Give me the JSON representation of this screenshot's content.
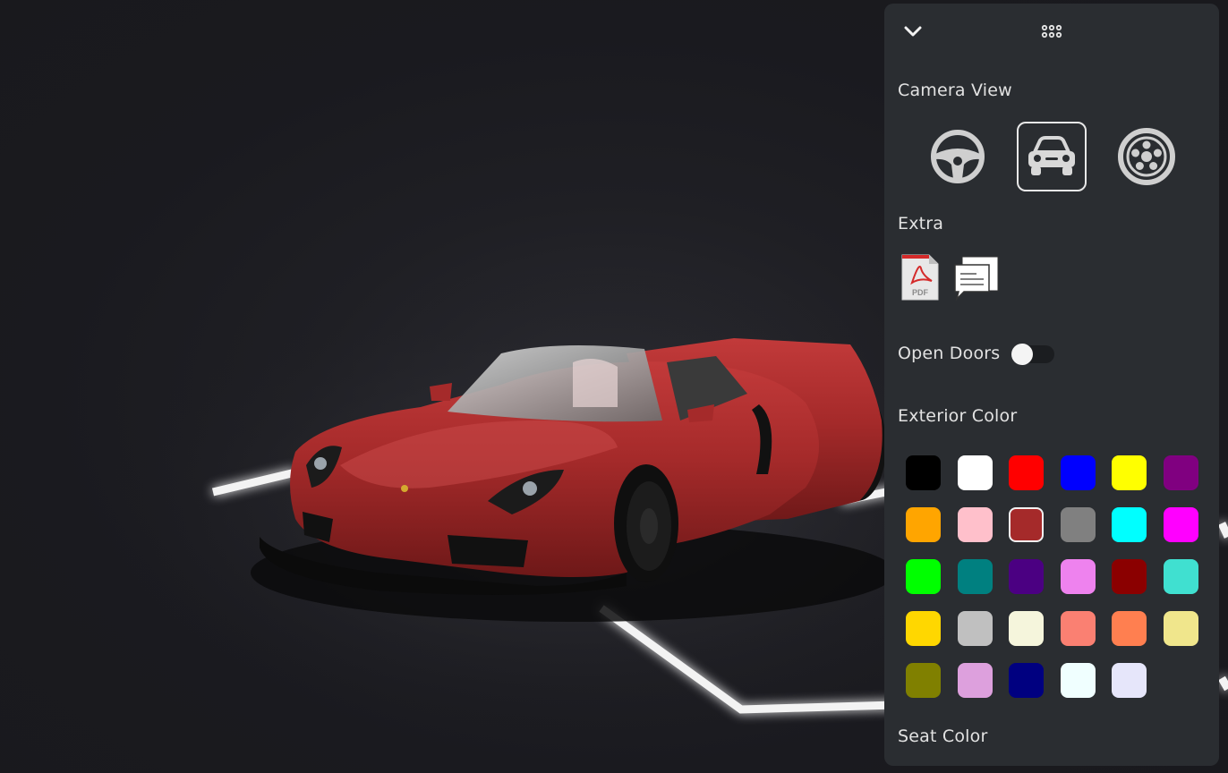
{
  "panel": {
    "camera_view_title": "Camera View",
    "camera_views": [
      {
        "name": "steering-wheel",
        "selected": false
      },
      {
        "name": "car-front",
        "selected": true
      },
      {
        "name": "wheel-rim",
        "selected": false
      }
    ],
    "extra_title": "Extra",
    "extra_items": [
      {
        "name": "pdf-document-icon",
        "label": "PDF"
      },
      {
        "name": "chat-comments-icon"
      }
    ],
    "open_doors_label": "Open Doors",
    "open_doors_on": false,
    "exterior_color_title": "Exterior Color",
    "exterior_colors": [
      "#000000",
      "#ffffff",
      "#ff0000",
      "#0000ff",
      "#ffff00",
      "#800080",
      "#ffa500",
      "#ffc0cb",
      "#a52a2a",
      "#808080",
      "#00ffff",
      "#ff00ff",
      "#00ff00",
      "#008080",
      "#4b0082",
      "#ee82ee",
      "#8b0000",
      "#40e0d0",
      "#ffd700",
      "#c0c0c0",
      "#f5f5dc",
      "#fa8072",
      "#ff7f50",
      "#f0e68c",
      "#808000",
      "#dda0dd",
      "#000080",
      "#f0ffff",
      "#e6e6fa"
    ],
    "selected_exterior_color": "#a52a2a",
    "seat_color_title": "Seat Color"
  },
  "scene": {
    "car_body_color": "#a52a2a"
  }
}
